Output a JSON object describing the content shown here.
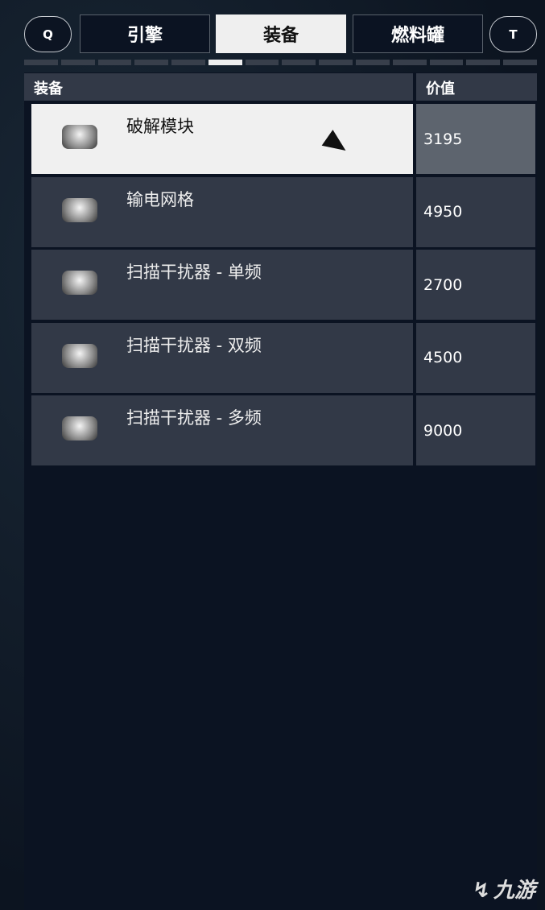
{
  "tabs": {
    "left_key": "Q",
    "right_key": "T",
    "items": [
      {
        "label": "引擎"
      },
      {
        "label": "装备",
        "active": true
      },
      {
        "label": "燃料罐"
      }
    ]
  },
  "page_indicator": {
    "total": 14,
    "active": 6
  },
  "table": {
    "headers": {
      "name": "装备",
      "value": "价值"
    },
    "rows": [
      {
        "name": "破解模块",
        "value": "3195",
        "selected": true
      },
      {
        "name": "输电网格",
        "value": "4950"
      },
      {
        "name": "扫描干扰器 - 单频",
        "value": "2700"
      },
      {
        "name": "扫描干扰器 - 双频",
        "value": "4500"
      },
      {
        "name": "扫描干扰器 - 多频",
        "value": "9000"
      }
    ]
  },
  "watermark": {
    "glyph": "↯",
    "text": "九游"
  }
}
